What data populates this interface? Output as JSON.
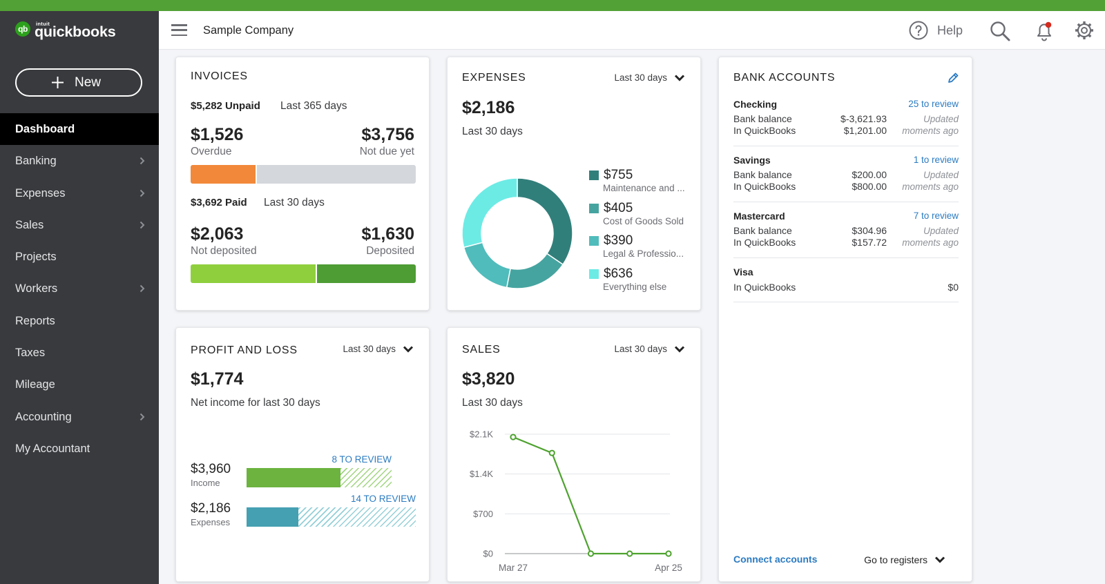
{
  "app": {
    "brand_prefix": "intuit",
    "brand": "quickbooks",
    "logo_mark": "qb",
    "company": "Sample Company"
  },
  "header": {
    "help_label": "Help",
    "icons": [
      "menu-hamburger-icon",
      "help-icon",
      "search-icon",
      "notification-bell-icon",
      "settings-gear-icon"
    ],
    "notification_dot_color": "#d52b1e"
  },
  "sidebar": {
    "new_label": "New",
    "items": [
      {
        "label": "Dashboard",
        "active": true,
        "submenu": false
      },
      {
        "label": "Banking",
        "active": false,
        "submenu": true
      },
      {
        "label": "Expenses",
        "active": false,
        "submenu": true
      },
      {
        "label": "Sales",
        "active": false,
        "submenu": true
      },
      {
        "label": "Projects",
        "active": false,
        "submenu": false
      },
      {
        "label": "Workers",
        "active": false,
        "submenu": true
      },
      {
        "label": "Reports",
        "active": false,
        "submenu": false
      },
      {
        "label": "Taxes",
        "active": false,
        "submenu": false
      },
      {
        "label": "Mileage",
        "active": false,
        "submenu": false
      },
      {
        "label": "Accounting",
        "active": false,
        "submenu": true
      },
      {
        "label": "My Accountant",
        "active": false,
        "submenu": false
      }
    ]
  },
  "colors": {
    "brand_green": "#52a136",
    "sidebar_bg": "#393a3d",
    "link_blue": "#2b7bc1",
    "overdue_orange": "#f2883a",
    "not_due_gray": "#d4d7dc",
    "not_deposited_green": "#8fcf3e",
    "deposited_green": "#4e9c34",
    "income_green": "#6cb33f",
    "income_hatch": "#9fd47c",
    "expense_teal": "#45a0b2",
    "expense_hatch": "#93cfd7",
    "sales_line": "#4ea22f"
  },
  "invoices": {
    "title": "INVOICES",
    "unpaid_label": "$5,282 Unpaid",
    "unpaid_period": "Last 365 days",
    "overdue": {
      "amount": "$1,526",
      "value": 1526,
      "label": "Overdue"
    },
    "not_due": {
      "amount": "$3,756",
      "value": 3756,
      "label": "Not due yet"
    },
    "paid_label": "$3,692 Paid",
    "paid_period": "Last 30 days",
    "not_deposited": {
      "amount": "$2,063",
      "value": 2063,
      "label": "Not deposited"
    },
    "deposited": {
      "amount": "$1,630",
      "value": 1630,
      "label": "Deposited"
    }
  },
  "expenses": {
    "title": "EXPENSES",
    "range": "Last 30 days",
    "total": "$2,186",
    "period": "Last 30 days",
    "legend": [
      {
        "amount": "$755",
        "label": "Maintenance and ..."
      },
      {
        "amount": "$405",
        "label": "Cost of Goods Sold"
      },
      {
        "amount": "$390",
        "label": "Legal & Professio..."
      },
      {
        "amount": "$636",
        "label": "Everything else"
      }
    ]
  },
  "profit_loss": {
    "title": "PROFIT AND LOSS",
    "range": "Last 30 days",
    "net": "$1,774",
    "subtitle": "Net income for last 30 days",
    "income": {
      "amount": "$3,960",
      "label": "Income",
      "review": "8 TO REVIEW",
      "solid_fraction": 0.555,
      "total_fraction": 0.857
    },
    "expenses": {
      "amount": "$2,186",
      "label": "Expenses",
      "review": "14 TO REVIEW",
      "solid_fraction": 0.306,
      "total_fraction": 1.0
    }
  },
  "sales": {
    "title": "SALES",
    "range": "Last 30 days",
    "total": "$3,820",
    "period": "Last 30 days"
  },
  "bank_accounts": {
    "title": "BANK ACCOUNTS",
    "accounts": [
      {
        "name": "Checking",
        "review": "25 to review",
        "rows": [
          {
            "label": "Bank balance",
            "value": "$-3,621.93"
          },
          {
            "label": "In QuickBooks",
            "value": "$1,201.00"
          }
        ],
        "updated": [
          "Updated",
          "moments ago"
        ]
      },
      {
        "name": "Savings",
        "review": "1 to review",
        "rows": [
          {
            "label": "Bank balance",
            "value": "$200.00"
          },
          {
            "label": "In QuickBooks",
            "value": "$800.00"
          }
        ],
        "updated": [
          "Updated",
          "moments ago"
        ]
      },
      {
        "name": "Mastercard",
        "review": "7 to review",
        "rows": [
          {
            "label": "Bank balance",
            "value": "$304.96"
          },
          {
            "label": "In QuickBooks",
            "value": "$157.72"
          }
        ],
        "updated": [
          "Updated",
          "moments ago"
        ]
      },
      {
        "name": "Visa",
        "rows": [
          {
            "label": "In QuickBooks",
            "value": "$0"
          }
        ]
      }
    ],
    "connect_label": "Connect accounts",
    "registers_label": "Go to registers"
  },
  "chart_data": [
    {
      "type": "pie",
      "donut": true,
      "title": "EXPENSES",
      "subtitle": "Last 30 days",
      "total": 2186,
      "start": "top",
      "direction": "clockwise",
      "slices": [
        {
          "label": "Maintenance and ...",
          "value": 755,
          "color": "#317f7b"
        },
        {
          "label": "Cost of Goods Sold",
          "value": 405,
          "color": "#46a4a0"
        },
        {
          "label": "Legal & Professio...",
          "value": 390,
          "color": "#50bcbb"
        },
        {
          "label": "Everything else",
          "value": 636,
          "color": "#6cebe5"
        }
      ],
      "legend": "right"
    },
    {
      "type": "line",
      "title": "SALES",
      "subtitle": "Last 30 days",
      "x_labels": [
        "Mar 27",
        "Apr 25"
      ],
      "values": [
        2050,
        1770,
        0,
        0,
        0
      ],
      "ylim": [
        0,
        2100
      ],
      "yticks": [
        0,
        700,
        1400,
        2100
      ],
      "ytick_labels": [
        "$0",
        "$700",
        "$1.4K",
        "$2.1K"
      ],
      "grid": true,
      "xlabel": "",
      "ylabel": ""
    }
  ]
}
